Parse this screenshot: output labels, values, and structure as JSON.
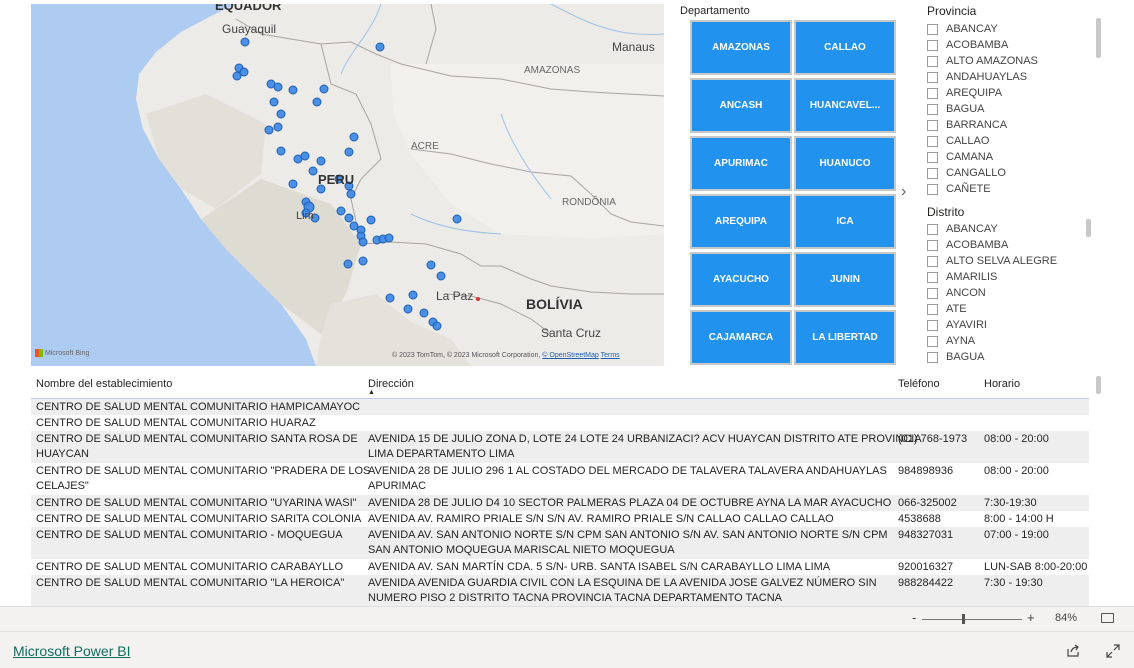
{
  "map": {
    "labels": {
      "ecuador": "EQUADOR",
      "guayaquil": "Guayaquil",
      "manaus": "Manaus",
      "amazonas": "AMAZONAS",
      "acre": "ACRE",
      "peru": "PERU",
      "rondonia": "RONDÔNIA",
      "lima": "Lim",
      "lapaz": "La Paz",
      "bolivia": "BOLÍVIA",
      "santacruz": "Santa Cruz"
    },
    "bing": "Microsoft Bing",
    "attribution_text": "© 2023 TomTom, © 2023 Microsoft Corporation, ",
    "attribution_osm": "© OpenStreetMap",
    "attribution_terms": "Terms",
    "point_color": "#3a86e6"
  },
  "departamento": {
    "title": "Departamento",
    "tiles": [
      "AMAZONAS",
      "CALLAO",
      "ANCASH",
      "HUANCAVEL...",
      "APURIMAC",
      "HUANUCO",
      "AREQUIPA",
      "ICA",
      "AYACUCHO",
      "JUNIN",
      "CAJAMARCA",
      "LA LIBERTAD"
    ],
    "tile_color": "#2192ee"
  },
  "provincia": {
    "title": "Provincia",
    "items": [
      "ABANCAY",
      "ACOBAMBA",
      "ALTO AMAZONAS",
      "ANDAHUAYLAS",
      "AREQUIPA",
      "BAGUA",
      "BARRANCA",
      "CALLAO",
      "CAMANA",
      "CANGALLO",
      "CAÑETE"
    ]
  },
  "distrito": {
    "title": "Distrito",
    "items": [
      "ABANCAY",
      "ACOBAMBA",
      "ALTO SELVA ALEGRE",
      "AMARILIS",
      "ANCON",
      "ATE",
      "AYAVIRI",
      "AYNA",
      "BAGUA"
    ]
  },
  "table": {
    "headers": {
      "nombre": "Nombre del establecimiento",
      "direccion": "Dirección",
      "telefono": "Teléfono",
      "horario": "Horario"
    },
    "rows": [
      {
        "nombre": [
          "CENTRO DE SALUD MENTAL COMUNITARIO HAMPICAMAYOC"
        ],
        "direccion": [
          ""
        ],
        "telefono": "",
        "horario": ""
      },
      {
        "nombre": [
          "CENTRO DE SALUD MENTAL COMUNITARIO HUARAZ"
        ],
        "direccion": [
          ""
        ],
        "telefono": "",
        "horario": ""
      },
      {
        "nombre": [
          "CENTRO DE SALUD MENTAL COMUNITARIO SANTA ROSA DE",
          "HUAYCAN"
        ],
        "direccion": [
          "AVENIDA 15 DE JULIO ZONA D, LOTE 24 LOTE 24 URBANIZACI? ACV HUAYCAN DISTRITO ATE PROVINCIA",
          "LIMA DEPARTAMENTO LIMA"
        ],
        "telefono": "(01) 768-1973",
        "horario": "08:00 - 20:00"
      },
      {
        "nombre": [
          "CENTRO DE SALUD MENTAL COMUNITARIO \"PRADERA DE LOS",
          "CELAJES\""
        ],
        "direccion": [
          "AVENIDA 28 DE JULIO 296 1 AL COSTADO DEL MERCADO DE TALAVERA TALAVERA ANDAHUAYLAS",
          "APURIMAC"
        ],
        "telefono": "984898936",
        "horario": "08:00 - 20:00"
      },
      {
        "nombre": [
          "CENTRO DE SALUD MENTAL COMUNITARIO \"UYARINA WASI\""
        ],
        "direccion": [
          "AVENIDA 28 DE JULIO D4 10 SECTOR PALMERAS PLAZA 04 DE OCTUBRE AYNA LA MAR AYACUCHO"
        ],
        "telefono": "066-325002",
        "horario": "7:30-19:30"
      },
      {
        "nombre": [
          "CENTRO DE SALUD MENTAL COMUNITARIO SARITA COLONIA"
        ],
        "direccion": [
          "AVENIDA AV. RAMIRO PRIALE S/N S/N AV. RAMIRO PRIALE S/N CALLAO CALLAO CALLAO"
        ],
        "telefono": "4538688",
        "horario": "8:00 - 14:00 H"
      },
      {
        "nombre": [
          "CENTRO DE SALUD MENTAL COMUNITARIO - MOQUEGUA"
        ],
        "direccion": [
          "AVENIDA AV. SAN ANTONIO NORTE S/N CPM SAN ANTONIO S/N AV. SAN ANTONIO NORTE S/N CPM",
          "SAN ANTONIO MOQUEGUA MARISCAL NIETO MOQUEGUA"
        ],
        "telefono": "948327031",
        "horario": "07:00 - 19:00"
      },
      {
        "nombre": [
          "CENTRO DE SALUD MENTAL COMUNITARIO CARABAYLLO"
        ],
        "direccion": [
          "AVENIDA AV. SAN MARTÍN CDA. 5 S/N- URB. SANTA ISABEL S/N CARABAYLLO LIMA LIMA"
        ],
        "telefono": "920016327",
        "horario": "LUN-SAB 8:00-20:00"
      },
      {
        "nombre": [
          "CENTRO DE SALUD MENTAL COMUNITARIO \"LA HEROICA\""
        ],
        "direccion": [
          "AVENIDA AVENIDA GUARDIA CIVIL CON LA ESQUINA DE LA AVENIDA JOSE GALVEZ NÚMERO SIN",
          "NUMERO PISO 2 DISTRITO TACNA PROVINCIA TACNA DEPARTAMENTO TACNA"
        ],
        "telefono": "988284422",
        "horario": "7:30 - 19:30"
      }
    ]
  },
  "zoom": {
    "minus": "-",
    "plus": "+",
    "level": 84,
    "level_label": "84%"
  },
  "footer": {
    "brand": "Microsoft Power BI"
  }
}
